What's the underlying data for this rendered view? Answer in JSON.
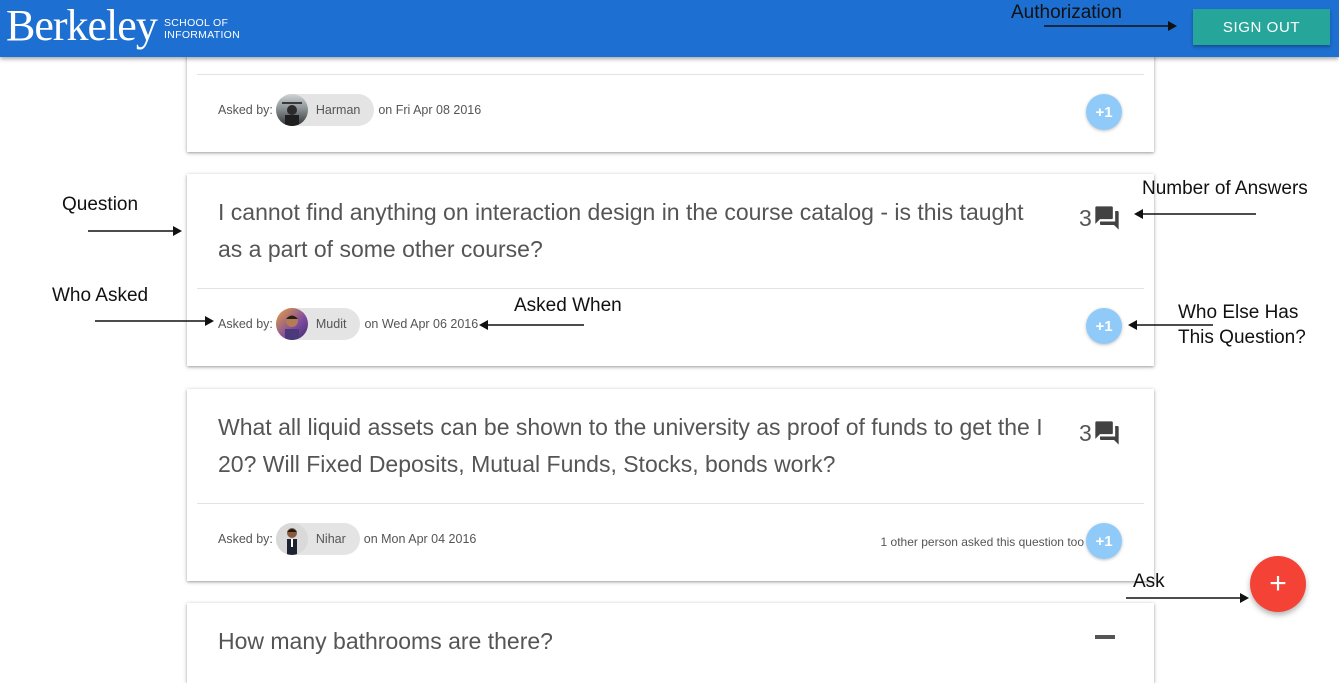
{
  "header": {
    "logo_word": "Berkeley",
    "logo_sub_1": "SCHOOL OF",
    "logo_sub_2": "INFORMATION",
    "signout_label": "SIGN OUT",
    "colors": {
      "bar": "#1d6fd1",
      "signout": "#26a69a"
    }
  },
  "annotations": {
    "authorization": "Authorization",
    "question": "Question",
    "number_of_answers": "Number of Answers",
    "who_asked": "Who Asked",
    "asked_when": "Asked When",
    "who_else_1": "Who Else Has",
    "who_else_2": "This Question?",
    "ask": "Ask"
  },
  "questions": [
    {
      "asked_by_label": "Asked by:",
      "user": "Harman",
      "date": "on Fri Apr 08 2016",
      "plus_one": "+1"
    },
    {
      "text": "I cannot find anything on interaction design in the course catalog - is this taught as a part of some other course?",
      "answers": "3",
      "asked_by_label": "Asked by:",
      "user": "Mudit",
      "date": "on Wed Apr 06 2016",
      "plus_one": "+1"
    },
    {
      "text": "What all liquid assets can be shown to the university as proof of funds to get the I 20? Will Fixed Deposits, Mutual Funds, Stocks, bonds work?",
      "answers": "3",
      "asked_by_label": "Asked by:",
      "user": "Nihar",
      "date": "on Mon Apr 04 2016",
      "others": "1 other person asked this question too",
      "plus_one": "+1"
    },
    {
      "text": "How many bathrooms are there?"
    }
  ],
  "fab": {
    "label": "+",
    "color": "#f44336"
  }
}
